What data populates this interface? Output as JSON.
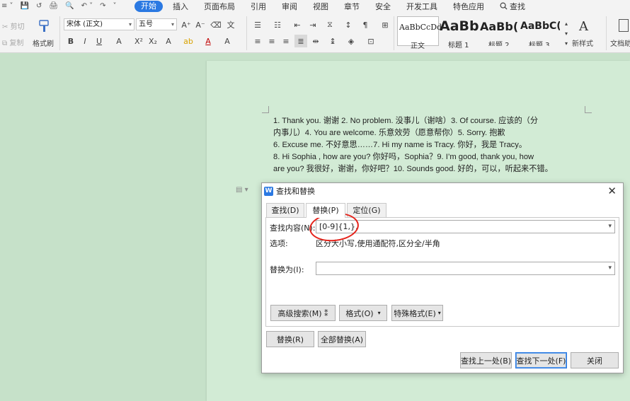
{
  "menubar": {
    "quick": [
      "≡ ˅",
      "💾",
      "↺",
      "🖨",
      "🔍",
      "↶ ˅",
      "↷",
      "˅"
    ],
    "tabs": [
      "开始",
      "插入",
      "页面布局",
      "引用",
      "审阅",
      "视图",
      "章节",
      "安全",
      "开发工具",
      "特色应用"
    ],
    "search_label": "查找"
  },
  "ribbon": {
    "cut_label": "剪切",
    "copy_label": "复制",
    "format_painter_label": "格式刷",
    "font_name": "宋体 (正文)",
    "font_size": "五号",
    "styles": [
      {
        "sample": "AaBbCcDd",
        "label": "正文"
      },
      {
        "sample": "AaBb",
        "label": "标题 1"
      },
      {
        "sample": "AaBb(",
        "label": "标题 2"
      },
      {
        "sample": "AaBbC(",
        "label": "标题 3"
      }
    ],
    "new_style_label": "新样式",
    "doc_tools_label": "文档助"
  },
  "document": {
    "lines": [
      "1.      Thank you. 谢谢 2.       No problem. 没事儿（谢啥）3.       Of course. 应该的（分",
      "内事儿）4.          You are welcome. 乐意效劳（愿意帮你）5.          Sorry. 抱歉",
      "6.          Excuse me. 不好意思……7.           Hi my name is Tracy. 你好，我是 Tracy。",
      "8.        Hi Sophia , how are you? 你好吗，Sophia？9.        I’m good, thank you, how",
      "are you? 我很好，谢谢，你好吧？10.    Sounds good. 好的，可以，听起来不错。"
    ]
  },
  "dialog": {
    "title": "查找和替换",
    "tabs": [
      "查找(D)",
      "替换(P)",
      "定位(G)"
    ],
    "find_label": "查找内容(N):",
    "find_value": "[0-9]{1,}.",
    "options_label": "选项:",
    "options_value": "区分大小写,使用通配符,区分全/半角",
    "replace_label": "替换为(I):",
    "replace_value": "",
    "advanced_button": "高级搜索(M) ⁑",
    "format_button": "格式(O)",
    "special_button": "特殊格式(E)",
    "replace_button": "替换(R)",
    "replace_all_button": "全部替换(A)",
    "find_prev_button": "查找上一处(B)",
    "find_next_button": "查找下一处(F)",
    "close_button": "关闭"
  },
  "colors": {
    "accent": "#2b79e2",
    "document_bg": "#c6e1c9",
    "annotation_circle": "#e5231b"
  }
}
